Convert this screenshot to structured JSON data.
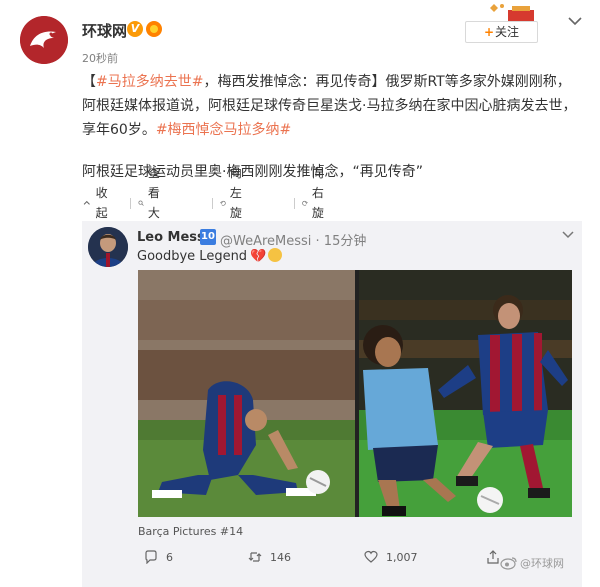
{
  "post": {
    "username": "环球网",
    "verify_badge": "V",
    "timestamp": "20秒前",
    "follow_label": "关注",
    "follow_plus": "+",
    "text": {
      "bracket_open": "【",
      "topic1": "#马拉多纳去世#",
      "part1": "，梅西发推悼念：再见传奇】俄罗斯RT等多家外媒刚刚称，阿根廷媒体报道说，阿根廷足球传奇巨星迭戈·马拉多纳在家中因心脏病发去世，享年60岁。",
      "topic2": "#梅西悼念马拉多纳#",
      "line2": "阿根廷足球运动员里奥·梅西刚刚发推悼念，“再见传奇”"
    },
    "toolbar": {
      "collapse": "收起",
      "view_large": "查看大图",
      "rotate_left": "向左旋转",
      "rotate_right": "向右旋转"
    }
  },
  "card": {
    "name": "Leo Messi",
    "badge": "10",
    "handle": "@WeAreMessi · 15分钟",
    "text": "Goodbye Legend",
    "caption": "Barça Pictures #14",
    "comments": "6",
    "retweets": "146",
    "likes": "1,007"
  },
  "watermark": "@环球网",
  "icons": {
    "verify": "verified-v-icon",
    "vip": "vip-icon",
    "collapse": "collapse-arrow-icon",
    "view_large": "magnifier-icon",
    "rotate_left": "rotate-left-icon",
    "rotate_right": "rotate-right-icon",
    "comment": "comment-icon",
    "retweet": "retweet-icon",
    "like": "heart-icon",
    "share": "share-icon",
    "more": "chevron-down-icon"
  },
  "colors": {
    "brand_red": "#b3262b",
    "link": "#eb7350",
    "follow_plus": "#ff8200",
    "card_bg": "#f2f2f5"
  }
}
